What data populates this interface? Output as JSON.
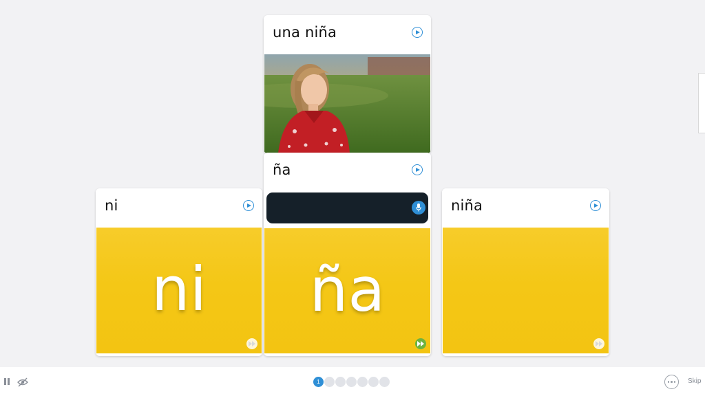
{
  "cards": {
    "top": {
      "word": "una niña"
    },
    "middle": {
      "word": "ña",
      "syllable": "ña"
    },
    "left": {
      "word": "ni",
      "syllable": "ni"
    },
    "right": {
      "word": "niña",
      "syllable": ""
    }
  },
  "progress": {
    "current_label": "1",
    "total_dots": 7,
    "current_index": 1
  },
  "footer": {
    "skip_label": "Skip"
  },
  "icons": {
    "play": "play-circle-icon",
    "mic": "microphone-icon",
    "fast_forward": "fast-forward-icon",
    "pause": "pause-icon",
    "hide": "eye-off-icon",
    "more": "more-options-icon"
  },
  "colors": {
    "accent": "#2f8fd6",
    "card_yellow": "#f4c716",
    "speak_bar": "#152029",
    "ff_active": "#6cb33f",
    "background": "#f2f2f4"
  }
}
